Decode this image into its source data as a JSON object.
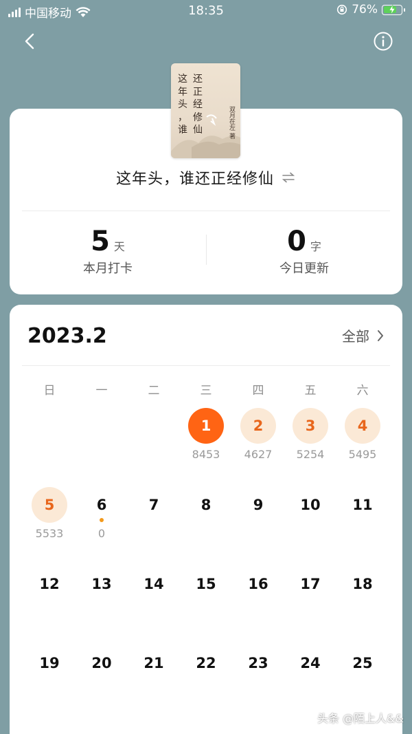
{
  "status_bar": {
    "carrier": "中国移动",
    "time": "18:35",
    "battery_percent": "76%",
    "battery_level": 0.76
  },
  "book": {
    "cover_columns": [
      [
        "还",
        "正",
        "经",
        "修",
        "仙"
      ],
      [
        "这",
        "年",
        "头",
        "，",
        "谁"
      ]
    ],
    "cover_author": "双月在左 著",
    "title": "这年头，谁还正经修仙"
  },
  "stats": [
    {
      "value": "5",
      "unit": "天",
      "label": "本月打卡"
    },
    {
      "value": "0",
      "unit": "字",
      "label": "今日更新"
    }
  ],
  "calendar": {
    "month": "2023.2",
    "all_label": "全部",
    "weekdays": [
      "日",
      "一",
      "二",
      "三",
      "四",
      "五",
      "六"
    ],
    "days": [
      {
        "day": "1",
        "count": "8453",
        "status": "today"
      },
      {
        "day": "2",
        "count": "4627",
        "status": "done"
      },
      {
        "day": "3",
        "count": "5254",
        "status": "done"
      },
      {
        "day": "4",
        "count": "5495",
        "status": "done"
      },
      {
        "day": "5",
        "count": "5533",
        "status": "done"
      },
      {
        "day": "6",
        "count": "0",
        "status": "dot"
      },
      {
        "day": "7",
        "count": "",
        "status": "none"
      },
      {
        "day": "8",
        "count": "",
        "status": "none"
      },
      {
        "day": "9",
        "count": "",
        "status": "none"
      },
      {
        "day": "10",
        "count": "",
        "status": "none"
      },
      {
        "day": "11",
        "count": "",
        "status": "none"
      },
      {
        "day": "12",
        "count": "",
        "status": "none"
      },
      {
        "day": "13",
        "count": "",
        "status": "none"
      },
      {
        "day": "14",
        "count": "",
        "status": "none"
      },
      {
        "day": "15",
        "count": "",
        "status": "none"
      },
      {
        "day": "16",
        "count": "",
        "status": "none"
      },
      {
        "day": "17",
        "count": "",
        "status": "none"
      },
      {
        "day": "18",
        "count": "",
        "status": "none"
      },
      {
        "day": "19",
        "count": "",
        "status": "none"
      },
      {
        "day": "20",
        "count": "",
        "status": "none"
      },
      {
        "day": "21",
        "count": "",
        "status": "none"
      },
      {
        "day": "22",
        "count": "",
        "status": "none"
      },
      {
        "day": "23",
        "count": "",
        "status": "none"
      },
      {
        "day": "24",
        "count": "",
        "status": "none"
      },
      {
        "day": "25",
        "count": "",
        "status": "none"
      }
    ],
    "first_weekday_index": 3
  },
  "colors": {
    "background": "#7f9ea4",
    "accent": "#ff6414",
    "done_bg": "#fbe9d6",
    "done_text": "#e8661c",
    "dot": "#f39a1c"
  },
  "watermark": "头条 @陌上人&&"
}
